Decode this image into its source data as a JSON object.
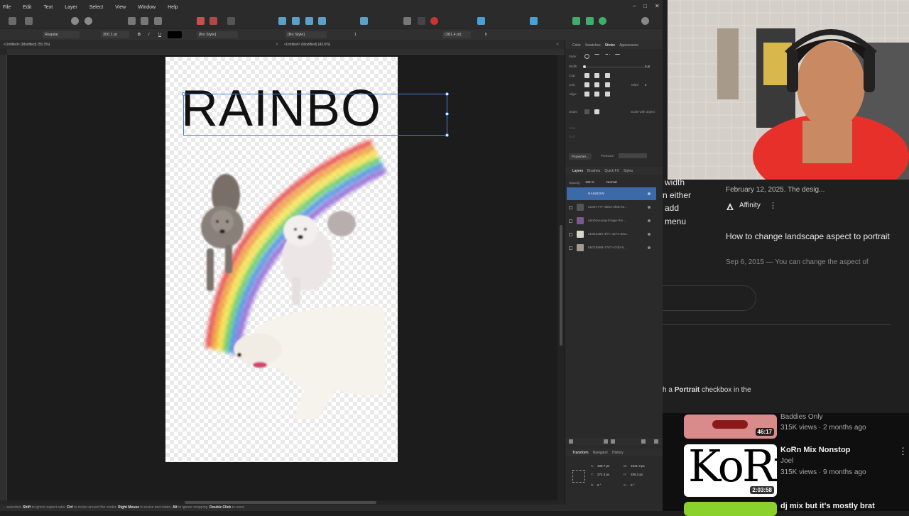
{
  "menubar": {
    "items": [
      "File",
      "Edit",
      "Text",
      "Layer",
      "Select",
      "View",
      "Window",
      "Help"
    ]
  },
  "contextbar": {
    "font_style": "Regular",
    "font_size": "350.1 pt",
    "bold": "B",
    "italic": "I",
    "underline": "U",
    "char_style": "[No Style]",
    "para_style": "[No Style]",
    "para_indent": "1",
    "tracking": "(381.4 pt)",
    "ligature": "fi"
  },
  "tabs": {
    "tab1": "<Untitled> (Modified) (55.3%)",
    "tab2": "<Untitled> (Modified) (43.6%)"
  },
  "canvas": {
    "text_content": "RAINBO"
  },
  "panel": {
    "top_tabs": [
      "Color",
      "Swatches",
      "Stroke",
      "Appearance"
    ],
    "style_label": "Style:",
    "width_label": "Width:",
    "width_value": "0 pt",
    "cap_label": "Cap:",
    "join_label": "Join:",
    "mitre_label": "Mitre:",
    "mitre_value": "2",
    "align_label": "Align:",
    "order_label": "Order:",
    "scale_label": "Scale with object",
    "start_label": "Start:",
    "end_label": "End:",
    "properties_btn": "Properties...",
    "pressure_label": "Pressure:",
    "layer_tabs": [
      "Layers",
      "Brushes",
      "Quick FX",
      "Styles"
    ],
    "opacity_label": "Opacity:",
    "opacity_value": "100 %",
    "blend_mode": "Normal",
    "layers": [
      {
        "name": "RAINBOW",
        "selected": true
      },
      {
        "name": "22347777-3b63-4f5b-b3...",
        "selected": false
      },
      {
        "name": "rainbow-png-image-the...",
        "selected": false
      },
      {
        "name": "c1881a56-3f7c-4274-a0a...",
        "selected": false
      },
      {
        "name": "b507d888-3757-47d0-8...",
        "selected": false
      }
    ],
    "bottom_tabs": [
      "Transform",
      "Navigator",
      "History"
    ],
    "transform": {
      "x_label": "X:",
      "x_value": "108.7 px",
      "y_label": "Y:",
      "y_value": "274.3 px",
      "w_label": "W:",
      "w_value": "1641.3 px",
      "h_label": "H:",
      "h_value": "259.3 px",
      "r_label": "R:",
      "r_value": "0 °",
      "s_label": "S:",
      "s_value": "0 °"
    }
  },
  "statusbar": {
    "text_parts": [
      {
        "t": "... selection. ",
        "b": false
      },
      {
        "t": "Shift",
        "b": true
      },
      {
        "t": " to ignore aspect ratio. ",
        "b": false
      },
      {
        "t": "Ctrl",
        "b": true
      },
      {
        "t": " to resize around the center. ",
        "b": false
      },
      {
        "t": "Right Mouse",
        "b": true
      },
      {
        "t": " to resize and rotate. ",
        "b": false
      },
      {
        "t": "Alt",
        "b": true
      },
      {
        "t": " to ignore snapping. ",
        "b": false
      },
      {
        "t": "Double Click",
        "b": true
      },
      {
        "t": " to reset.",
        "b": false
      }
    ]
  },
  "browser": {
    "partial_left_lines": [
      "width",
      "n either",
      "add",
      "menu"
    ],
    "result1_date_partial": "February 12, 2025. The desig...",
    "result1_source": "Affinity",
    "result2_title": "How to change landscape aspect to portrait",
    "result2_snippet": "Sep 6, 2015 — You can change the aspect of",
    "bottom_partial_prefix": "h a ",
    "bottom_partial_bold": "Portrait",
    "bottom_partial_suffix": " checkbox in the"
  },
  "youtube": {
    "items": [
      {
        "channel_partial": "Baddies Only",
        "views": "315K views · 2 months ago",
        "duration": "46:17"
      },
      {
        "title": "KoRn Mix Nonstop",
        "channel": "Joel",
        "views": "315K views · 9 months ago",
        "duration": "2:03:58",
        "thumb_text": "KoRn"
      },
      {
        "title": "dj mix but it's mostly brat"
      }
    ]
  },
  "colors": {
    "accent_blue": "#4a7fd1",
    "selected_layer": "#3c6aa8",
    "app_bg": "#252525"
  }
}
